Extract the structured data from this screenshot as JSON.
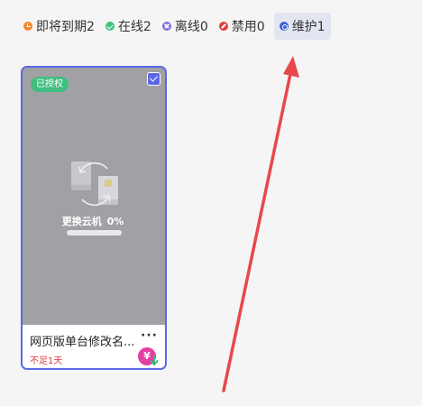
{
  "filters": [
    {
      "label": "即将到期2",
      "icon": "expiring-icon",
      "color": "#f08a32",
      "active": false
    },
    {
      "label": "在线2",
      "icon": "online-icon",
      "color": "#3dc47e",
      "active": false
    },
    {
      "label": "离线0",
      "icon": "offline-icon",
      "color": "#7a6ee6",
      "active": false
    },
    {
      "label": "禁用0",
      "icon": "disabled-icon",
      "color": "#e33b3b",
      "active": false
    },
    {
      "label": "维护1",
      "icon": "maintenance-icon",
      "color": "#3b62d8",
      "active": true
    }
  ],
  "device_card": {
    "badge": "已授权",
    "status_text": "更换云机",
    "progress_label": "0%",
    "progress": 0,
    "name": "网页版单台修改名...",
    "expire_note": "不足1天",
    "renew_icon_text": "¥",
    "selected": true
  },
  "colors": {
    "accent": "#5a68e6",
    "badge": "#3fbf7f",
    "warning": "#e0363e",
    "annotation_arrow": "#e8484b"
  }
}
